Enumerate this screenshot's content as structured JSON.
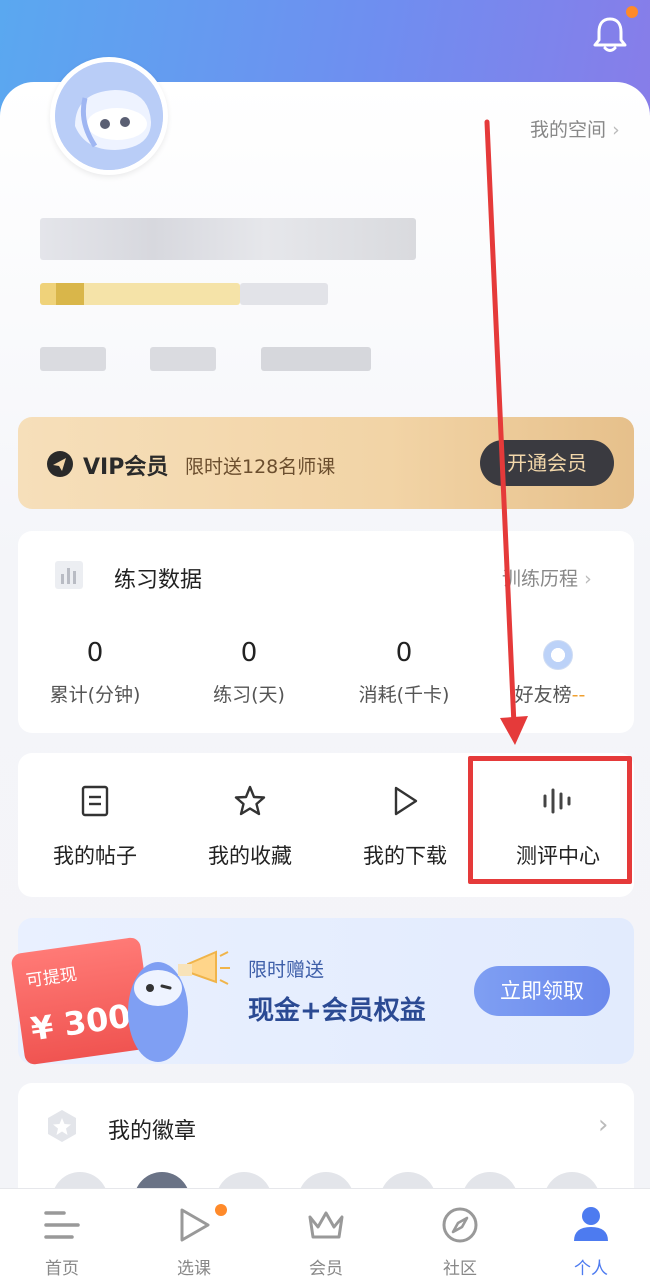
{
  "header": {
    "my_space_label": "我的空间",
    "notification_badge": true
  },
  "vip": {
    "title": "VIP会员",
    "subtitle": "限时送128名师课",
    "button_label": "开通会员"
  },
  "practice": {
    "title": "练习数据",
    "link_label": "训练历程",
    "stats": [
      {
        "value": "0",
        "label": "累计(分钟)"
      },
      {
        "value": "0",
        "label": "练习(天)"
      },
      {
        "value": "0",
        "label": "消耗(千卡)"
      }
    ],
    "friends_label": "好友榜",
    "friends_suffix": "--"
  },
  "menu": {
    "items": [
      {
        "label": "我的帖子",
        "icon": "post-icon"
      },
      {
        "label": "我的收藏",
        "icon": "star-icon"
      },
      {
        "label": "我的下载",
        "icon": "play-icon"
      },
      {
        "label": "测评中心",
        "icon": "waveform-icon"
      }
    ],
    "highlight_color": "#e53a3a"
  },
  "promo": {
    "ticket_label": "可提现",
    "ticket_amount": "¥ 300",
    "subtitle": "限时赠送",
    "title": "现金+会员权益",
    "button_label": "立即领取"
  },
  "badges": {
    "title": "我的徽章"
  },
  "tabbar": {
    "items": [
      {
        "label": "首页",
        "icon": "home-icon",
        "active": false
      },
      {
        "label": "选课",
        "icon": "course-play-icon",
        "active": false,
        "dot": true
      },
      {
        "label": "会员",
        "icon": "crown-icon",
        "active": false
      },
      {
        "label": "社区",
        "icon": "compass-icon",
        "active": false
      },
      {
        "label": "个人",
        "icon": "person-icon",
        "active": true
      }
    ],
    "active_color": "#4d7bf0",
    "inactive_color": "#888888"
  },
  "colors": {
    "accent": "#4d7bf0",
    "annotation_red": "#e53a3a",
    "vip_gold": "#f2d4a6",
    "notification_orange": "#ff8a2a"
  }
}
